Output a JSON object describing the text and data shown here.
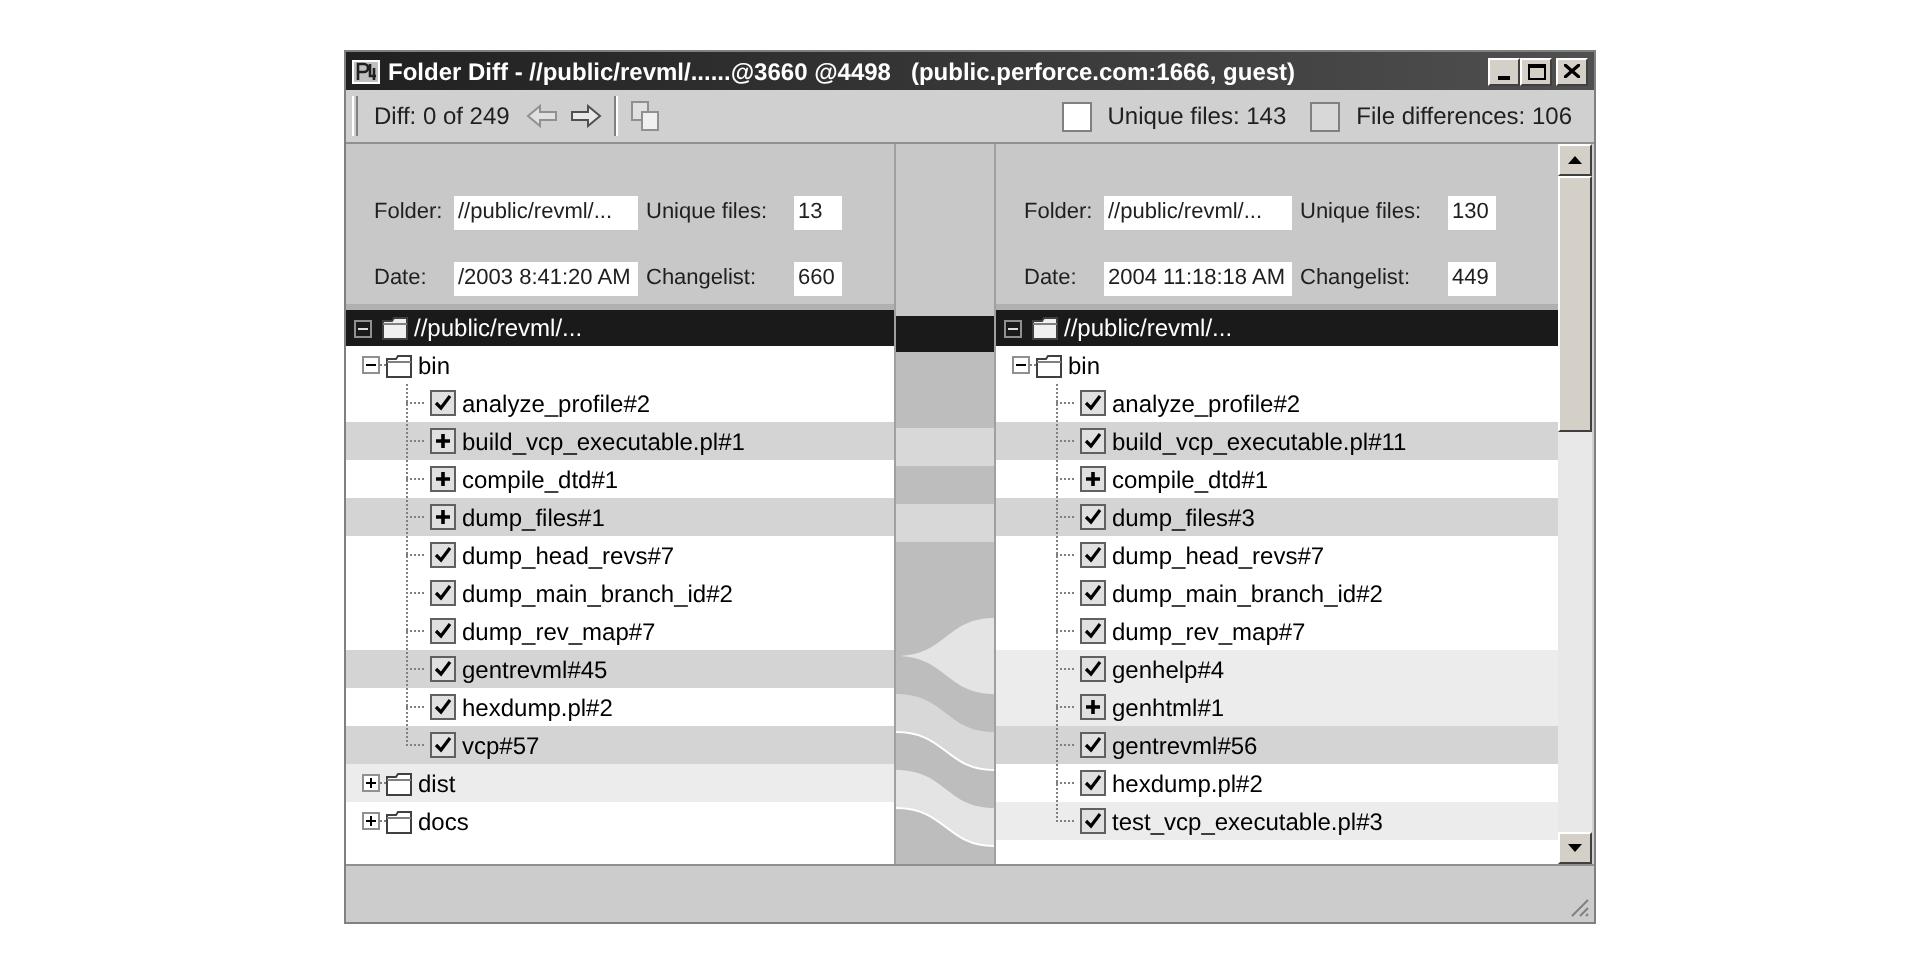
{
  "window": {
    "title": "Folder Diff - //public/revml/......@3660 @4498   (public.perforce.com:1666, guest)"
  },
  "toolbar": {
    "diff_counter": "Diff: 0 of 249",
    "legend": [
      {
        "label": "Unique files: 143",
        "color": "#ffffff"
      },
      {
        "label": "File differences: 106",
        "color": "#d8d8d8"
      }
    ]
  },
  "panes": [
    {
      "info": {
        "folder_label": "Folder:",
        "folder": "//public/revml/...",
        "unique_label": "Unique files:",
        "unique": "13",
        "date_label": "Date:",
        "date": "/2003 8:41:20 AM",
        "changelist_label": "Changelist:",
        "changelist": "660"
      },
      "tree": {
        "label": "//public/revml/...",
        "expanded": true,
        "children": [
          {
            "kind": "folder",
            "label": "bin",
            "expanded": true,
            "differs": false,
            "unmatched": false,
            "children": [
              {
                "kind": "file",
                "label": "analyze_profile#2",
                "added": false,
                "differs": false,
                "unmatched": false
              },
              {
                "kind": "file",
                "label": "build_vcp_executable.pl#1",
                "added": true,
                "differs": true,
                "unmatched": false
              },
              {
                "kind": "file",
                "label": "compile_dtd#1",
                "added": true,
                "differs": false,
                "unmatched": false
              },
              {
                "kind": "file",
                "label": "dump_files#1",
                "added": true,
                "differs": true,
                "unmatched": false
              },
              {
                "kind": "file",
                "label": "dump_head_revs#7",
                "added": false,
                "differs": false,
                "unmatched": false
              },
              {
                "kind": "file",
                "label": "dump_main_branch_id#2",
                "added": false,
                "differs": false,
                "unmatched": false
              },
              {
                "kind": "file",
                "label": "dump_rev_map#7",
                "added": false,
                "differs": false,
                "unmatched": false
              },
              {
                "kind": "file",
                "label": "gentrevml#45",
                "added": false,
                "differs": true,
                "unmatched": false
              },
              {
                "kind": "file",
                "label": "hexdump.pl#2",
                "added": false,
                "differs": false,
                "unmatched": false
              },
              {
                "kind": "file",
                "label": "vcp#57",
                "added": false,
                "differs": true,
                "unmatched": false
              }
            ]
          },
          {
            "kind": "folder",
            "label": "dist",
            "expanded": false,
            "differs": false,
            "unmatched": true
          },
          {
            "kind": "folder",
            "label": "docs",
            "expanded": false,
            "differs": false,
            "unmatched": false
          }
        ]
      }
    },
    {
      "info": {
        "folder_label": "Folder:",
        "folder": "//public/revml/...",
        "unique_label": "Unique files:",
        "unique": "130",
        "date_label": "Date:",
        "date": "2004 11:18:18 AM",
        "changelist_label": "Changelist:",
        "changelist": "449"
      },
      "tree": {
        "label": "//public/revml/...",
        "expanded": true,
        "children": [
          {
            "kind": "folder",
            "label": "bin",
            "expanded": true,
            "differs": false,
            "unmatched": false,
            "children": [
              {
                "kind": "file",
                "label": "analyze_profile#2",
                "added": false,
                "differs": false,
                "unmatched": false
              },
              {
                "kind": "file",
                "label": "build_vcp_executable.pl#11",
                "added": false,
                "differs": true,
                "unmatched": false
              },
              {
                "kind": "file",
                "label": "compile_dtd#1",
                "added": true,
                "differs": false,
                "unmatched": false
              },
              {
                "kind": "file",
                "label": "dump_files#3",
                "added": false,
                "differs": true,
                "unmatched": false
              },
              {
                "kind": "file",
                "label": "dump_head_revs#7",
                "added": false,
                "differs": false,
                "unmatched": false
              },
              {
                "kind": "file",
                "label": "dump_main_branch_id#2",
                "added": false,
                "differs": false,
                "unmatched": false
              },
              {
                "kind": "file",
                "label": "dump_rev_map#7",
                "added": false,
                "differs": false,
                "unmatched": false
              },
              {
                "kind": "file",
                "label": "genhelp#4",
                "added": false,
                "differs": false,
                "unmatched": true
              },
              {
                "kind": "file",
                "label": "genhtml#1",
                "added": true,
                "differs": false,
                "unmatched": true
              },
              {
                "kind": "file",
                "label": "gentrevml#56",
                "added": false,
                "differs": true,
                "unmatched": false
              },
              {
                "kind": "file",
                "label": "hexdump.pl#2",
                "added": false,
                "differs": false,
                "unmatched": false
              },
              {
                "kind": "file",
                "label": "test_vcp_executable.pl#3",
                "added": false,
                "differs": false,
                "unmatched": true
              }
            ]
          }
        ]
      }
    }
  ]
}
